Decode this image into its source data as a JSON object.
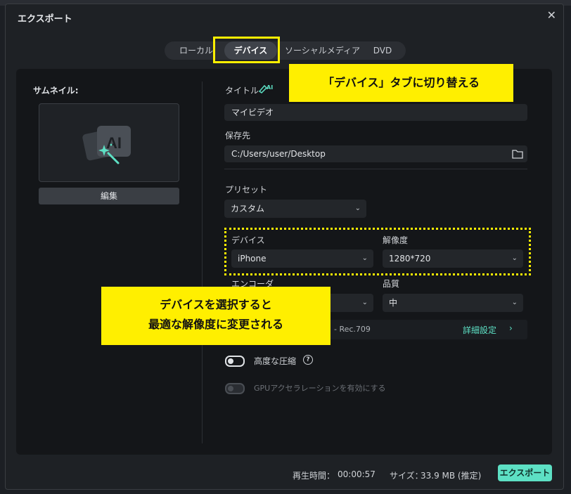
{
  "dialog": {
    "title": "エクスポート"
  },
  "tabs": [
    {
      "label": "ローカル"
    },
    {
      "label": "デバイス"
    },
    {
      "label": "ソーシャルメディア"
    },
    {
      "label": "DVD"
    }
  ],
  "thumbnail": {
    "label": "サムネイル:",
    "edit_label": "編集",
    "placeholder_text": "AI"
  },
  "form": {
    "title_label": "タイトル",
    "ai_badge": "AI",
    "title_value": "マイビデオ",
    "save_label": "保存先",
    "save_path": "C:/Users/user/Desktop",
    "preset_label": "プリセット",
    "preset_value": "カスタム",
    "device_label": "デバイス",
    "device_value": "iPhone",
    "resolution_label": "解像度",
    "resolution_value": "1280*720",
    "encoder_label": "エンコーダ",
    "quality_label": "品質",
    "quality_value": "中",
    "advanced_info": "- Rec.709",
    "advanced_link": "詳細設定",
    "compress_label": "高度な圧縮",
    "gpu_label": "GPUアクセラレーションを有効にする"
  },
  "callouts": {
    "tab": "「デバイス」タブに切り替える",
    "device_line1": "デバイスを選択すると",
    "device_line2": "最適な解像度に変更される"
  },
  "footer": {
    "duration_label": "再生時間：",
    "duration_value": "00:00:57",
    "size_label": "サイズ：",
    "size_value": "33.9 MB (推定)",
    "export_label": "エクスポート"
  },
  "colors": {
    "accent": "#5de0c4",
    "highlight": "#ffef00"
  }
}
